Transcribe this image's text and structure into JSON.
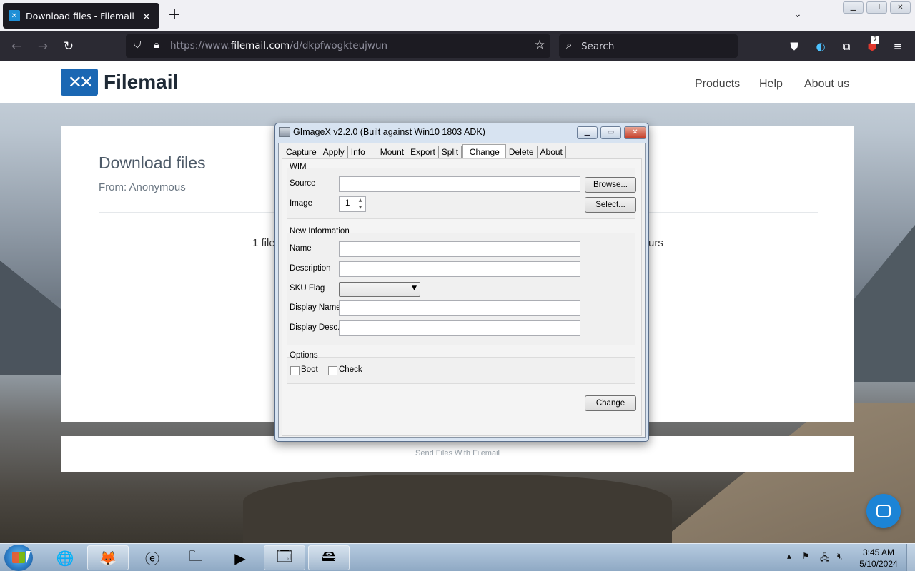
{
  "browser": {
    "tab_title": "Download files - Filemail",
    "url_scheme": "https://www.",
    "url_host": "filemail.com",
    "url_path": "/d/dkpfwogkteujwun",
    "search_placeholder": "Search",
    "extension_badge": "7"
  },
  "site": {
    "logo_text": "Filemail",
    "nav": [
      "Products",
      "Help",
      "About us"
    ],
    "card_title": "Download files",
    "card_from": "From: Anonymous",
    "body_left_fragment": "1 file",
    "body_right_fragment": "urs",
    "footer": "Send Files With Filemail"
  },
  "dialog": {
    "title": "GImageX v2.2.0 (Built against Win10 1803 ADK)",
    "tabs": [
      "Capture",
      "Apply",
      "Info",
      "Mount",
      "Export",
      "Split",
      "Change",
      "Delete",
      "About"
    ],
    "active_tab": "Change",
    "wim_group": "WIM",
    "source_label": "Source",
    "browse_label": "Browse...",
    "image_label": "Image",
    "image_value": "1",
    "select_label": "Select...",
    "new_info_group": "New Information",
    "name_label": "Name",
    "description_label": "Description",
    "sku_label": "SKU Flag",
    "display_name_label": "Display Name",
    "display_desc_label": "Display Desc.",
    "options_group": "Options",
    "boot_label": "Boot",
    "check_label": "Check",
    "change_button": "Change"
  },
  "taskbar": {
    "time": "3:45 AM",
    "date": "5/10/2024"
  },
  "colors": {
    "brand_blue": "#1a67b3",
    "browser_dark": "#1c1b22"
  }
}
